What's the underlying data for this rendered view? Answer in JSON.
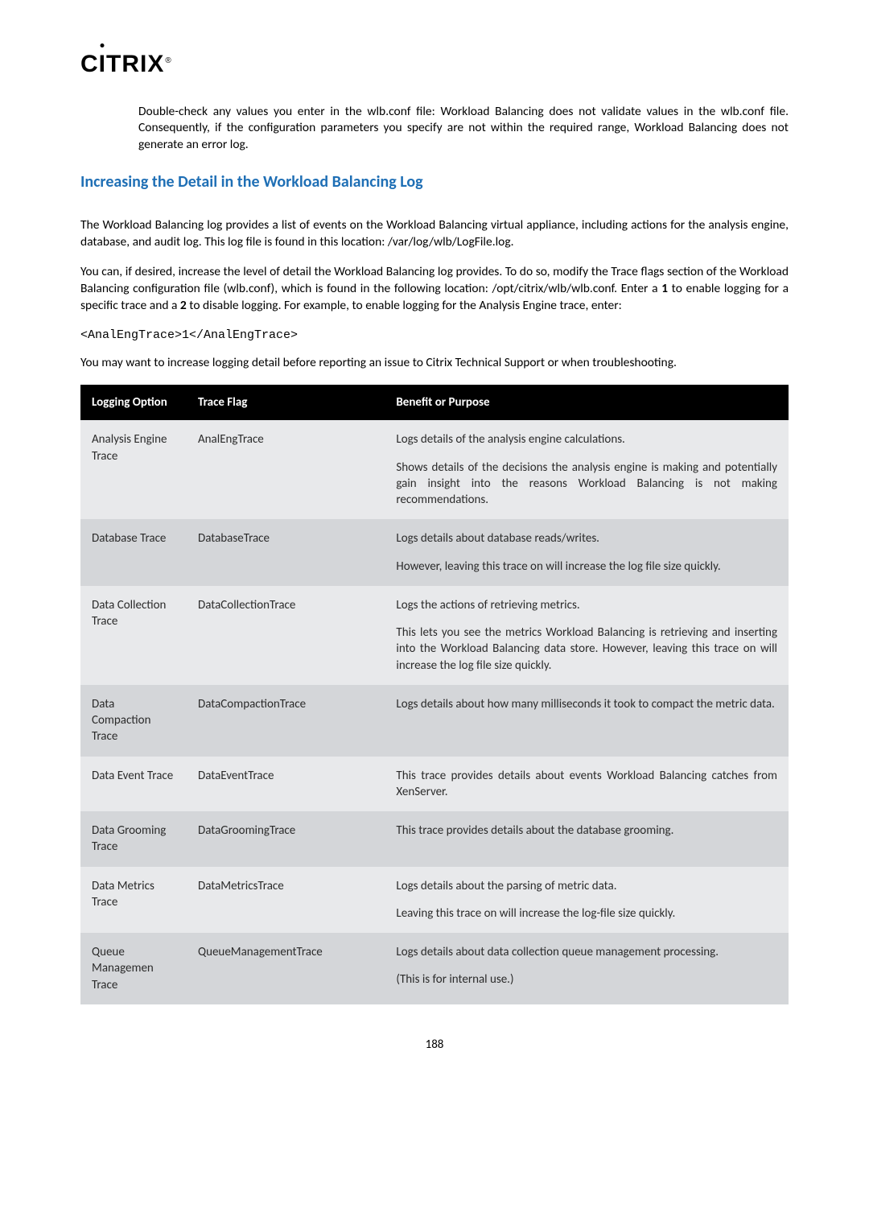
{
  "logo": {
    "text": "CİTRIX",
    "reg": "®"
  },
  "intro": "Double-check any values you enter in the wlb.conf file: Workload Balancing does not validate values in the wlb.conf file. Consequently, if the configuration parameters you specify are not within the required range, Workload Balancing does not generate an error log.",
  "heading": "Increasing the Detail in the Workload Balancing Log",
  "para1": "The Workload Balancing log provides a list of events on the Workload Balancing virtual appliance, including actions for the analysis engine, database, and audit log. This log file is found in this location: /var/log/wlb/LogFile.log.",
  "para2_a": "You can, if desired, increase the level of detail the Workload Balancing log provides. To do so, modify the Trace flags section of the Workload Balancing configuration file (wlb.conf), which is found in the following location: /opt/citrix/wlb/wlb.conf. Enter a ",
  "para2_b1": "1",
  "para2_c": " to enable logging for a specific trace and a ",
  "para2_b2": "2",
  "para2_d": " to disable logging. For example, to enable logging for the Analysis Engine trace, enter:",
  "code": "<AnalEngTrace>1</AnalEngTrace>",
  "para3": "You may want to increase logging detail before reporting an issue to Citrix Technical Support or when troubleshooting.",
  "table": {
    "headers": {
      "opt": "Logging Option",
      "flag": "Trace Flag",
      "ben": "Benefit or Purpose"
    },
    "rows": [
      {
        "shade": "light",
        "opt": "Analysis Engine Trace",
        "flag": "AnalEngTrace",
        "ben": [
          "Logs details of the analysis engine calculations.",
          "Shows details of the decisions the analysis engine is making and potentially gain insight into the reasons Workload Balancing is not making recommendations."
        ]
      },
      {
        "shade": "dark",
        "opt": "Database Trace",
        "flag": "DatabaseTrace",
        "ben": [
          "Logs details about database reads/writes.",
          "However, leaving this trace on will increase the log file size quickly."
        ]
      },
      {
        "shade": "light",
        "opt": "Data Collection Trace",
        "flag": "DataCollectionTrace",
        "ben": [
          "Logs the actions of retrieving metrics.",
          "This lets you see the metrics Workload Balancing is retrieving and inserting into the Workload Balancing data store. However, leaving this trace on will increase the log file size quickly."
        ]
      },
      {
        "shade": "dark",
        "opt": "Data Compaction Trace",
        "flag": "DataCompactionTrace",
        "ben": [
          "Logs details about how many milliseconds it took to compact the metric data."
        ]
      },
      {
        "shade": "light",
        "opt": "Data Event Trace",
        "flag": "DataEventTrace",
        "ben": [
          "This trace provides details about events Workload Balancing catches from XenServer."
        ]
      },
      {
        "shade": "dark",
        "opt": "Data Grooming Trace",
        "flag": "DataGroomingTrace",
        "ben": [
          "This trace provides details about the database grooming."
        ]
      },
      {
        "shade": "light",
        "opt": "Data Metrics Trace",
        "flag": "DataMetricsTrace",
        "ben": [
          "Logs details about the parsing of metric data.",
          "Leaving this trace on will increase the log-file size quickly."
        ]
      },
      {
        "shade": "dark",
        "opt": "Queue Managemen Trace",
        "flag": "QueueManagementTrace",
        "ben": [
          "Logs details about data collection queue management processing.",
          "(This is for internal use.)"
        ]
      }
    ]
  },
  "pagenum": "188"
}
